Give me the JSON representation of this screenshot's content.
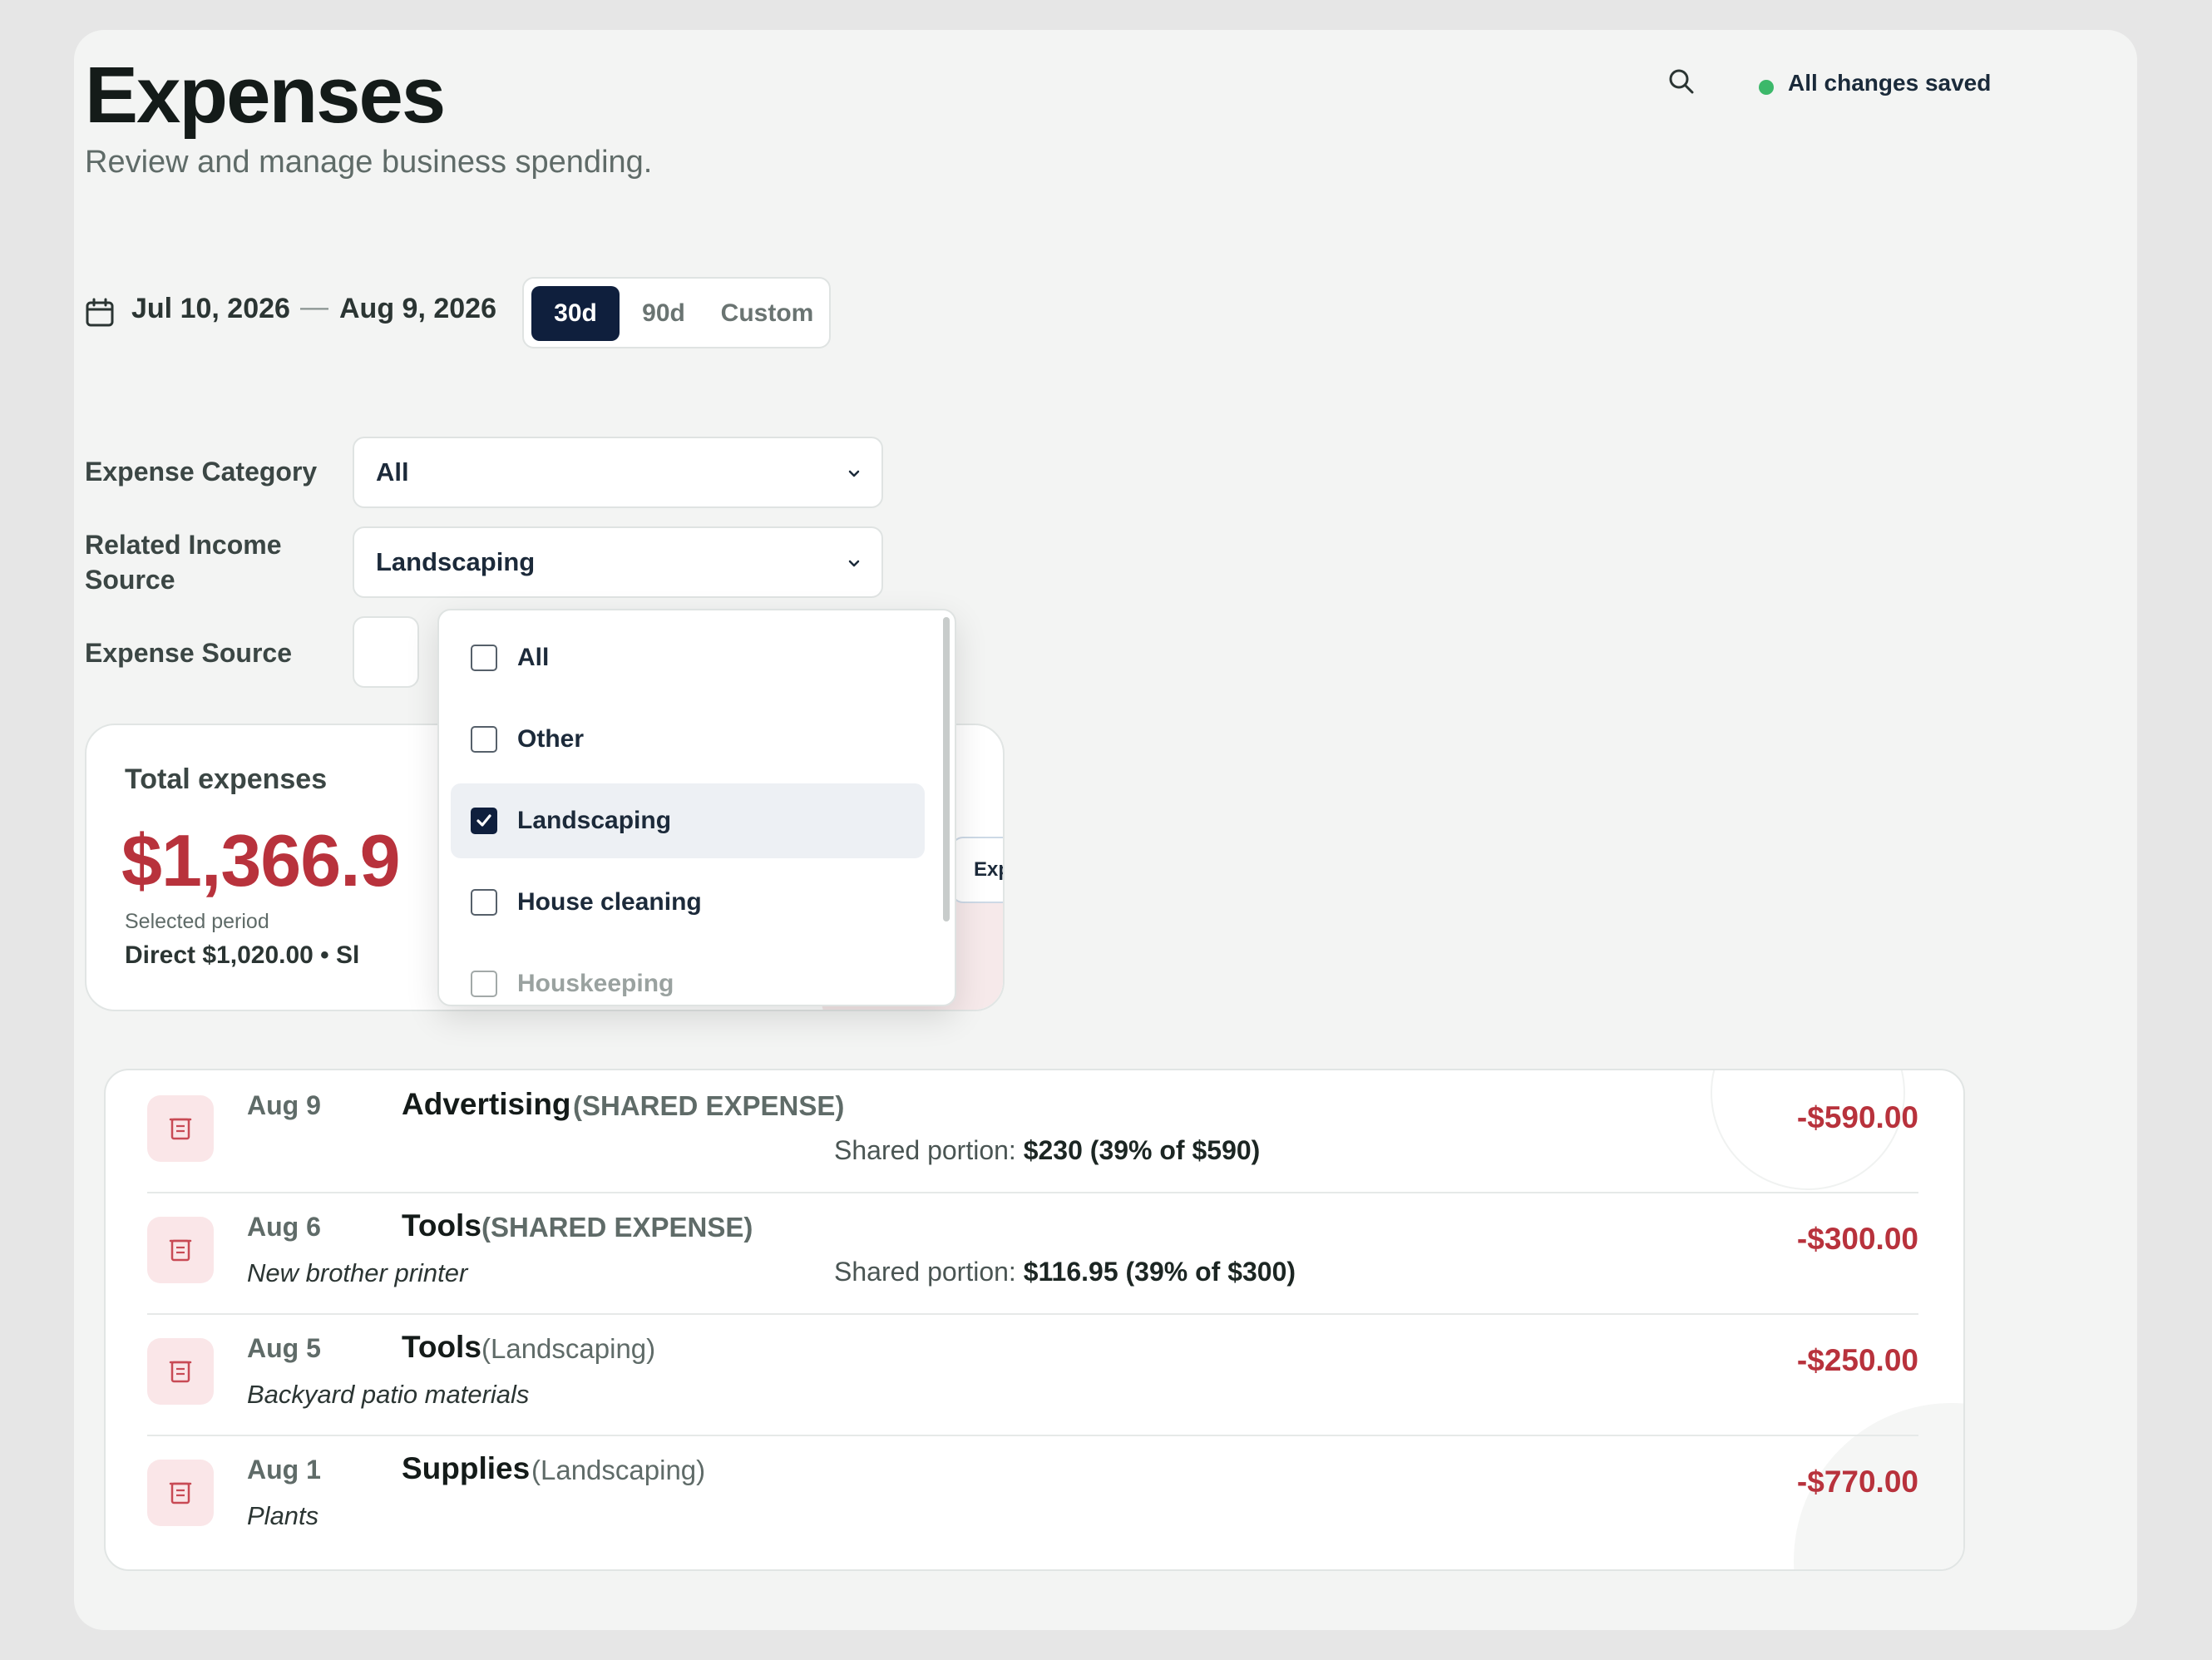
{
  "header": {
    "title": "Expenses",
    "subtitle": "Review and manage business spending.",
    "save_status": "All changes saved"
  },
  "date_range": {
    "from": "Jul 10, 2026",
    "separator": "—",
    "to": "Aug 9, 2026",
    "presets": [
      "30d",
      "90d",
      "Custom"
    ],
    "active_preset": "30d"
  },
  "filters": {
    "expense_category": {
      "label": "Expense Category",
      "value": "All"
    },
    "related_income_source": {
      "label": "Related Income Source",
      "value": "Landscaping"
    },
    "expense_source": {
      "label": "Expense Source",
      "value": ""
    }
  },
  "dropdown": {
    "options": [
      {
        "label": "All",
        "checked": false
      },
      {
        "label": "Other",
        "checked": false
      },
      {
        "label": "Landscaping",
        "checked": true
      },
      {
        "label": "House cleaning",
        "checked": false
      },
      {
        "label": "Houskeeping",
        "checked": false
      }
    ]
  },
  "summary": {
    "label": "Total expenses",
    "amount": "$1,366.9",
    "period": "Selected period",
    "breakdown": "Direct $1,020.00 • Sl",
    "export_label": "Export"
  },
  "transactions": [
    {
      "date": "Aug 9",
      "category": "Advertising",
      "tag": "(SHARED EXPENSE)",
      "note": "",
      "shared_label": "Shared portion:",
      "shared_value": "$230 (39% of $590)",
      "amount": "-$590.00"
    },
    {
      "date": "Aug 6",
      "category": "Tools",
      "tag": "(SHARED EXPENSE)",
      "note": "New brother printer",
      "shared_label": "Shared portion:",
      "shared_value": "$116.95 (39% of $300)",
      "amount": "-$300.00"
    },
    {
      "date": "Aug 5",
      "category": "Tools",
      "tag": "(Landscaping)",
      "note": "Backyard patio materials",
      "shared_label": "",
      "shared_value": "",
      "amount": "-$250.00"
    },
    {
      "date": "Aug 1",
      "category": "Supplies",
      "tag": "(Landscaping)",
      "note": "Plants",
      "shared_label": "",
      "shared_value": "",
      "amount": "-$770.00"
    }
  ],
  "colors": {
    "accent": "#0f1f3d",
    "negative": "#b8323c",
    "saved_dot": "#3cb86a"
  },
  "icons": [
    "search-icon",
    "calendar-icon",
    "chevron-down-icon",
    "checkbox-icon",
    "receipt-icon"
  ]
}
